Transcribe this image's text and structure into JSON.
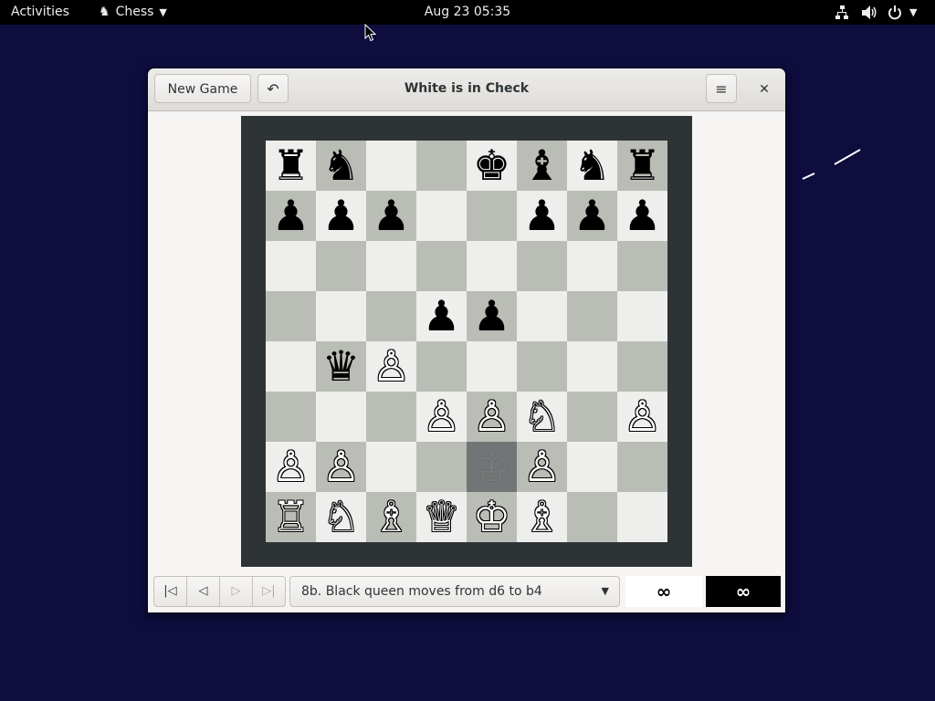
{
  "topbar": {
    "activities": "Activities",
    "app_name": "Chess",
    "clock": "Aug 23  05:35",
    "icons": [
      "chess-knight-icon",
      "network-icon",
      "volume-icon",
      "power-icon",
      "chevron-down-icon"
    ]
  },
  "window": {
    "title": "White is in Check",
    "new_game_label": "New Game",
    "undo_glyph": "↶",
    "menu_glyph": "≡",
    "close_glyph": "✕"
  },
  "board": {
    "light_color": "#eeeeec",
    "dark_color": "#babdb6",
    "frame_color": "#2e3436",
    "ranks": [
      {
        "rank": 8,
        "squares": [
          {
            "file": "a",
            "piece": "♜",
            "color": "black"
          },
          {
            "file": "b",
            "piece": "♞",
            "color": "black"
          },
          {
            "file": "c",
            "piece": "",
            "color": ""
          },
          {
            "file": "d",
            "piece": "",
            "color": ""
          },
          {
            "file": "e",
            "piece": "♚",
            "color": "black"
          },
          {
            "file": "f",
            "piece": "♝",
            "color": "black"
          },
          {
            "file": "g",
            "piece": "♞",
            "color": "black"
          },
          {
            "file": "h",
            "piece": "♜",
            "color": "black"
          }
        ]
      },
      {
        "rank": 7,
        "squares": [
          {
            "file": "a",
            "piece": "♟",
            "color": "black"
          },
          {
            "file": "b",
            "piece": "♟",
            "color": "black"
          },
          {
            "file": "c",
            "piece": "♟",
            "color": "black"
          },
          {
            "file": "d",
            "piece": "",
            "color": ""
          },
          {
            "file": "e",
            "piece": "",
            "color": ""
          },
          {
            "file": "f",
            "piece": "♟",
            "color": "black"
          },
          {
            "file": "g",
            "piece": "♟",
            "color": "black"
          },
          {
            "file": "h",
            "piece": "♟",
            "color": "black"
          }
        ]
      },
      {
        "rank": 6,
        "squares": [
          {
            "file": "a",
            "piece": "",
            "color": ""
          },
          {
            "file": "b",
            "piece": "",
            "color": ""
          },
          {
            "file": "c",
            "piece": "",
            "color": ""
          },
          {
            "file": "d",
            "piece": "",
            "color": ""
          },
          {
            "file": "e",
            "piece": "",
            "color": ""
          },
          {
            "file": "f",
            "piece": "",
            "color": ""
          },
          {
            "file": "g",
            "piece": "",
            "color": ""
          },
          {
            "file": "h",
            "piece": "",
            "color": ""
          }
        ]
      },
      {
        "rank": 5,
        "squares": [
          {
            "file": "a",
            "piece": "",
            "color": ""
          },
          {
            "file": "b",
            "piece": "",
            "color": ""
          },
          {
            "file": "c",
            "piece": "",
            "color": ""
          },
          {
            "file": "d",
            "piece": "♟",
            "color": "black"
          },
          {
            "file": "e",
            "piece": "♟",
            "color": "black"
          },
          {
            "file": "f",
            "piece": "",
            "color": ""
          },
          {
            "file": "g",
            "piece": "",
            "color": ""
          },
          {
            "file": "h",
            "piece": "",
            "color": ""
          }
        ]
      },
      {
        "rank": 4,
        "squares": [
          {
            "file": "a",
            "piece": "",
            "color": ""
          },
          {
            "file": "b",
            "piece": "♛",
            "color": "black"
          },
          {
            "file": "c",
            "piece": "♙",
            "color": "white"
          },
          {
            "file": "d",
            "piece": "",
            "color": ""
          },
          {
            "file": "e",
            "piece": "",
            "color": ""
          },
          {
            "file": "f",
            "piece": "",
            "color": ""
          },
          {
            "file": "g",
            "piece": "",
            "color": ""
          },
          {
            "file": "h",
            "piece": "",
            "color": ""
          }
        ]
      },
      {
        "rank": 3,
        "squares": [
          {
            "file": "a",
            "piece": "",
            "color": ""
          },
          {
            "file": "b",
            "piece": "",
            "color": ""
          },
          {
            "file": "c",
            "piece": "",
            "color": ""
          },
          {
            "file": "d",
            "piece": "♙",
            "color": "white"
          },
          {
            "file": "e",
            "piece": "♙",
            "color": "white"
          },
          {
            "file": "f",
            "piece": "♘",
            "color": "white"
          },
          {
            "file": "g",
            "piece": "",
            "color": ""
          },
          {
            "file": "h",
            "piece": "♙",
            "color": "white"
          }
        ]
      },
      {
        "rank": 2,
        "squares": [
          {
            "file": "a",
            "piece": "♙",
            "color": "white"
          },
          {
            "file": "b",
            "piece": "♙",
            "color": "white"
          },
          {
            "file": "c",
            "piece": "",
            "color": ""
          },
          {
            "file": "d",
            "piece": "",
            "color": ""
          },
          {
            "file": "e",
            "piece": "♔",
            "color": "ghost"
          },
          {
            "file": "f",
            "piece": "♙",
            "color": "white"
          },
          {
            "file": "g",
            "piece": "",
            "color": ""
          },
          {
            "file": "h",
            "piece": "",
            "color": ""
          }
        ]
      },
      {
        "rank": 1,
        "squares": [
          {
            "file": "a",
            "piece": "♖",
            "color": "white"
          },
          {
            "file": "b",
            "piece": "♘",
            "color": "white"
          },
          {
            "file": "c",
            "piece": "♗",
            "color": "white"
          },
          {
            "file": "d",
            "piece": "♕",
            "color": "white"
          },
          {
            "file": "e",
            "piece": "♔",
            "color": "white"
          },
          {
            "file": "f",
            "piece": "♗",
            "color": "white"
          },
          {
            "file": "g",
            "piece": "",
            "color": ""
          },
          {
            "file": "h",
            "piece": "",
            "color": ""
          }
        ]
      }
    ]
  },
  "history": {
    "nav": {
      "first": "|◁",
      "prev": "◁",
      "next": "▷",
      "last": "▷|"
    },
    "selected_move": "8b. Black queen moves from d6 to b4",
    "arrow": "▼"
  },
  "clocks": {
    "white": "∞",
    "black": "∞"
  }
}
